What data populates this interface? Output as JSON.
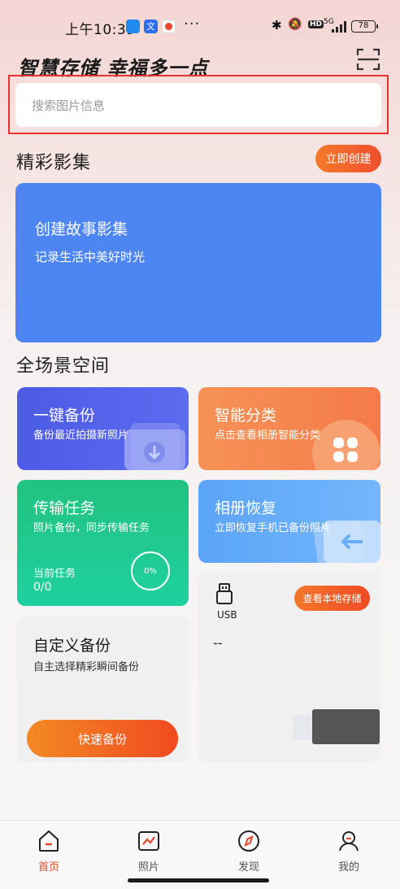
{
  "status_bar": {
    "time": "上午10:39",
    "network": "5G",
    "battery": "78"
  },
  "header": {
    "headline": "智慧存储 幸福多一点"
  },
  "search": {
    "placeholder": "搜索图片信息"
  },
  "albums": {
    "title": "精彩影集",
    "create_button": "立即创建",
    "banner_title": "创建故事影集",
    "banner_subtitle": "记录生活中美好时光"
  },
  "scenes": {
    "title": "全场景空间",
    "backup": {
      "title": "一键备份",
      "subtitle": "备份最近拍摄新照片"
    },
    "classify": {
      "title": "智能分类",
      "subtitle": "点击查看相册智能分类"
    },
    "transfer": {
      "title": "传输任务",
      "subtitle": "照片备份，同步传输任务",
      "current_label": "当前任务",
      "current_count": "0/0",
      "progress": "0%"
    },
    "restore": {
      "title": "相册恢复",
      "subtitle": "立即恢复手机已备份照片"
    },
    "custom": {
      "title": "自定义备份",
      "subtitle": "自主选择精彩瞬间备份",
      "button": "快速备份"
    },
    "usb": {
      "label": "USB",
      "value": "--",
      "button": "查看本地存储"
    }
  },
  "bottom_nav": {
    "items": [
      {
        "label": "首页",
        "icon": "home-icon",
        "active": true
      },
      {
        "label": "照片",
        "icon": "photo-icon",
        "active": false
      },
      {
        "label": "发现",
        "icon": "compass-icon",
        "active": false
      },
      {
        "label": "我的",
        "icon": "profile-icon",
        "active": false
      }
    ]
  },
  "colors": {
    "accent": "#ef4f2c",
    "banner": "#4d86f3",
    "backup": "#4d5be5",
    "classify": "#f57a4a",
    "transfer": "#22c27f",
    "restore": "#5ba4f7"
  }
}
